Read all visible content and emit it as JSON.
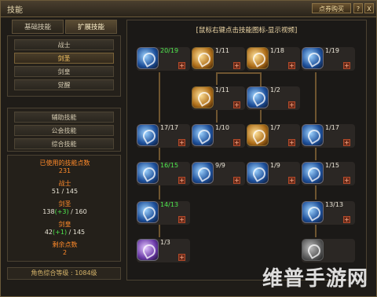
{
  "window": {
    "title": "技能",
    "shop_button": "点券购买",
    "help_button": "?",
    "close_button": "X"
  },
  "tabs": [
    "基础技能",
    "扩展技能"
  ],
  "categories": {
    "c0": "战士",
    "c1": "剑圣",
    "c2": "剑皇",
    "c3": "觉醒",
    "c4": "辅助技能",
    "c5": "公会技能",
    "c6": "综合技能"
  },
  "stats": {
    "used_label": "已使用的技能点数",
    "used_value": "231",
    "warrior_label": "战士",
    "warrior_value": "51 / 145",
    "sword_saint_label": "剑圣",
    "sword_saint_base": "138",
    "sword_saint_bonus": "(+3)",
    "sword_saint_rest": " / 160",
    "sword_king_label": "剑皇",
    "sword_king_base": "42",
    "sword_king_bonus": "(+1)",
    "sword_king_rest": " / 145",
    "remaining_label": "剩余点数",
    "remaining_value": "2"
  },
  "bottom_line": "角色综合等级 : 1084级",
  "tree_hint": "[鼠标右键点击技能图标-显示视频]",
  "skills": [
    {
      "level": "20/19",
      "level_color": "#4ee84e",
      "icon": "sword-slash-icon",
      "style": "blue"
    },
    {
      "level": "1/11",
      "level_color": "#e9e4d6",
      "icon": "sword-flame-icon",
      "style": "gold"
    },
    {
      "level": "1/18",
      "level_color": "#e9e4d6",
      "icon": "sword-strike-icon",
      "style": "gold"
    },
    {
      "level": "1/19",
      "level_color": "#e9e4d6",
      "icon": "sword-wave-icon",
      "style": "blue"
    },
    {
      "level": "1/11",
      "level_color": "#e9e4d6",
      "icon": "sword-guard-icon",
      "style": "gold"
    },
    {
      "level": "1/2",
      "level_color": "#e9e4d6",
      "icon": "sword-dash-icon",
      "style": "blue"
    },
    {
      "level": "17/17",
      "level_color": "#e9e4d6",
      "icon": "sword-circle-icon",
      "style": "blue"
    },
    {
      "level": "1/10",
      "level_color": "#e9e4d6",
      "icon": "sword-spin-icon",
      "style": "blue"
    },
    {
      "level": "1/7",
      "level_color": "#e9e4d6",
      "icon": "sword-aura-icon",
      "style": "gold"
    },
    {
      "level": "1/17",
      "level_color": "#e9e4d6",
      "icon": "sword-rift-icon",
      "style": "blue"
    },
    {
      "level": "16/15",
      "level_color": "#4ee84e",
      "icon": "sword-charge-icon",
      "style": "blue"
    },
    {
      "level": "9/9",
      "level_color": "#e9e4d6",
      "icon": "sword-pierce-icon",
      "style": "blue"
    },
    {
      "level": "1/9",
      "level_color": "#e9e4d6",
      "icon": "sword-burst-icon",
      "style": "blue"
    },
    {
      "level": "1/15",
      "level_color": "#e9e4d6",
      "icon": "sword-moon-icon",
      "style": "blue"
    },
    {
      "level": "14/13",
      "level_color": "#4ee84e",
      "icon": "sword-combo-icon",
      "style": "blue"
    },
    {
      "level": "13/13",
      "level_color": "#e9e4d6",
      "icon": "sword-storm-icon",
      "style": "blue"
    },
    {
      "level": "1/3",
      "level_color": "#e9e4d6",
      "icon": "sword-ultimate-icon",
      "style": "purple"
    },
    {
      "level": "",
      "level_color": "#e9e4d6",
      "icon": "sword-locked-icon",
      "style": "grey"
    }
  ],
  "watermark": "维普手游网"
}
